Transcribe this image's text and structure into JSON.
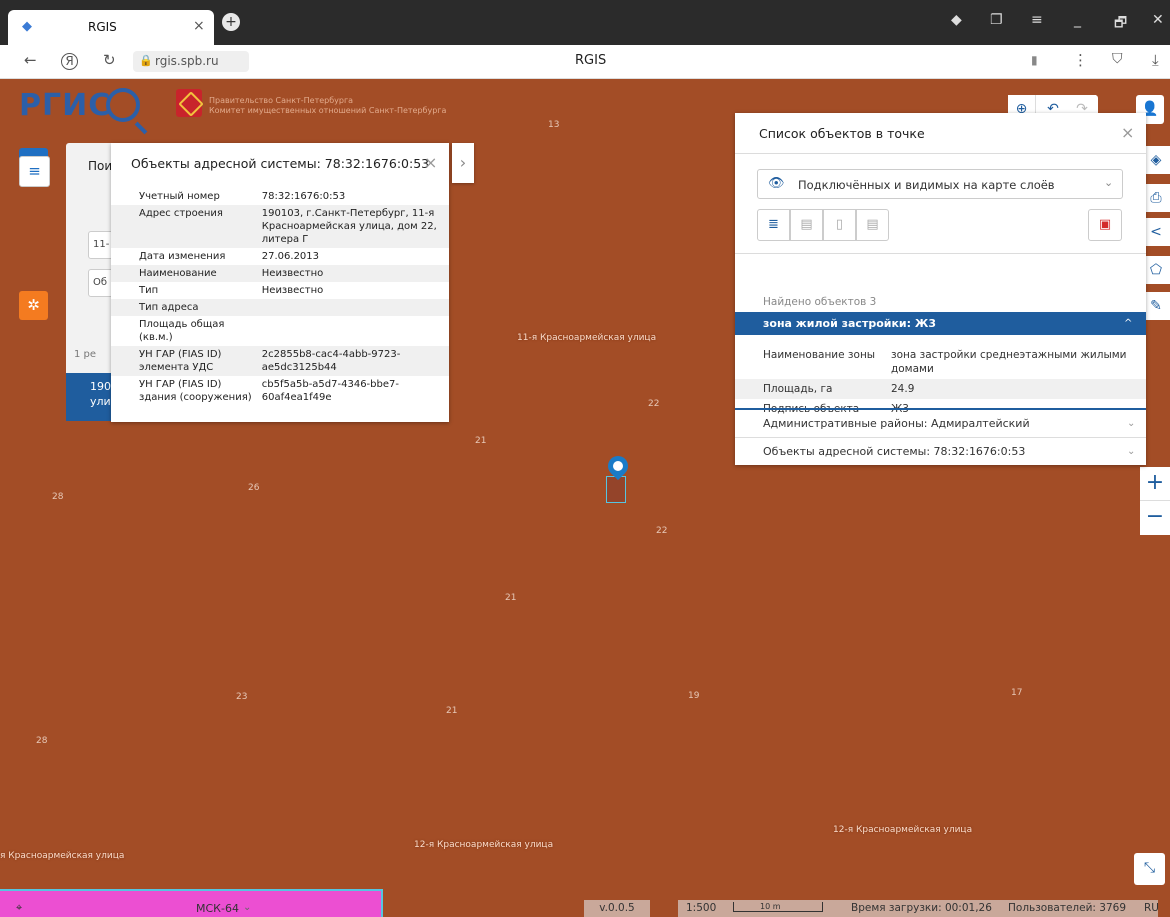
{
  "browser": {
    "tab_title": "RGIS",
    "tab_close": "×",
    "new_tab": "+",
    "url": "rgis.spb.ru",
    "page_title": "RGIS",
    "back": "←",
    "yandex": "Я",
    "reload": "↻",
    "menu": "⋮",
    "download": "⤓",
    "bookmark": "▮",
    "lock": "🔒",
    "win_controls": [
      "◆",
      "❐",
      "≡",
      "_",
      "🗗",
      "✕"
    ]
  },
  "header": {
    "logo_text": "РГИС",
    "gov_line1": "Правительство Санкт-Петербурга",
    "gov_line2": "Комитет имущественных отношений Санкт-Петербурга"
  },
  "left_controls": {
    "search_icon": "⌕",
    "menu_icon": "≡",
    "emblem_icon": "✲"
  },
  "search_panel": {
    "title": "Пои",
    "input1": "11-",
    "input2": "Об",
    "results": "1 ре",
    "selected_line1": "190",
    "selected_line2": "ули"
  },
  "address_popup": {
    "title": "Объекты адресной системы: 78:32:1676:0:53",
    "close": "×",
    "expand": "›",
    "rows": [
      {
        "label": "Учетный номер",
        "value": "78:32:1676:0:53"
      },
      {
        "label": "Адрес строения",
        "value": "190103, г.Санкт-Петербург, 11-я Красноармейская улица, дом 22, литера Г"
      },
      {
        "label": "Дата изменения",
        "value": "27.06.2013"
      },
      {
        "label": "Наименование",
        "value": "Неизвестно"
      },
      {
        "label": "Тип",
        "value": "Неизвестно"
      },
      {
        "label": "Тип адреса",
        "value": ""
      },
      {
        "label": "Площадь общая (кв.м.)",
        "value": ""
      },
      {
        "label": "УН ГАР (FIAS ID) элемента УДС",
        "value": "2c2855b8-cac4-4abb-9723-ae5dc3125b44"
      },
      {
        "label": "УН ГАР (FIAS ID) здания (сооружения)",
        "value": "cb5f5a5b-a5d7-4346-bbe7-60af4ea1f49e"
      }
    ]
  },
  "objects_panel": {
    "title": "Список объектов в точке",
    "close": "×",
    "dropdown_icon": "👁",
    "dropdown_value": "Подключённых и видимых на карте слоёв",
    "dropdown_chev": "⌄",
    "tool_icons": [
      "≣",
      "▤",
      "▯",
      "▤"
    ],
    "report_icon": "▣",
    "found": "Найдено объектов 3",
    "zone_title": "зона жилой застройки: Ж3",
    "zone_chev": "^",
    "zone_rows": [
      {
        "label": "Наименование зоны",
        "value": "зона застройки среднеэтажными жилыми домами"
      },
      {
        "label": "Площадь, га",
        "value": "24.9"
      },
      {
        "label": "Подпись объекта",
        "value": "Ж3"
      }
    ],
    "accordion": [
      {
        "label": "Административные районы: Адмиралтейский",
        "chev": "⌄"
      },
      {
        "label": "Объекты адресной системы: 78:32:1676:0:53",
        "chev": "⌄"
      }
    ]
  },
  "map_controls": {
    "globe": "⊕",
    "undo": "↶",
    "redo": "↷",
    "user": "👤",
    "layers": "◈",
    "print": "⎙",
    "share": "<",
    "select": "⬠",
    "measure": "✎",
    "zoom_in": "+",
    "zoom_out": "−",
    "fullscreen": "⤡"
  },
  "map_labels": {
    "numbers": [
      "13",
      "22",
      "21",
      "26",
      "28",
      "22",
      "21",
      "19",
      "23",
      "21",
      "17",
      "28"
    ],
    "streets": [
      "11-я Красноармейская улица",
      "12-я Красноармейская улица",
      "12-я Красноармейская улица",
      "я Красноармейская улица"
    ]
  },
  "status": {
    "crs": "МСК-64",
    "crs_chev": "⌄",
    "version": "v.0.0.5",
    "scale": "1:500",
    "scale_bar": "10 m",
    "load_time": "Время загрузки: 00:01,26",
    "users": "Пользователей: 3769",
    "lang": "RU",
    "pin_icon": "⬤"
  }
}
